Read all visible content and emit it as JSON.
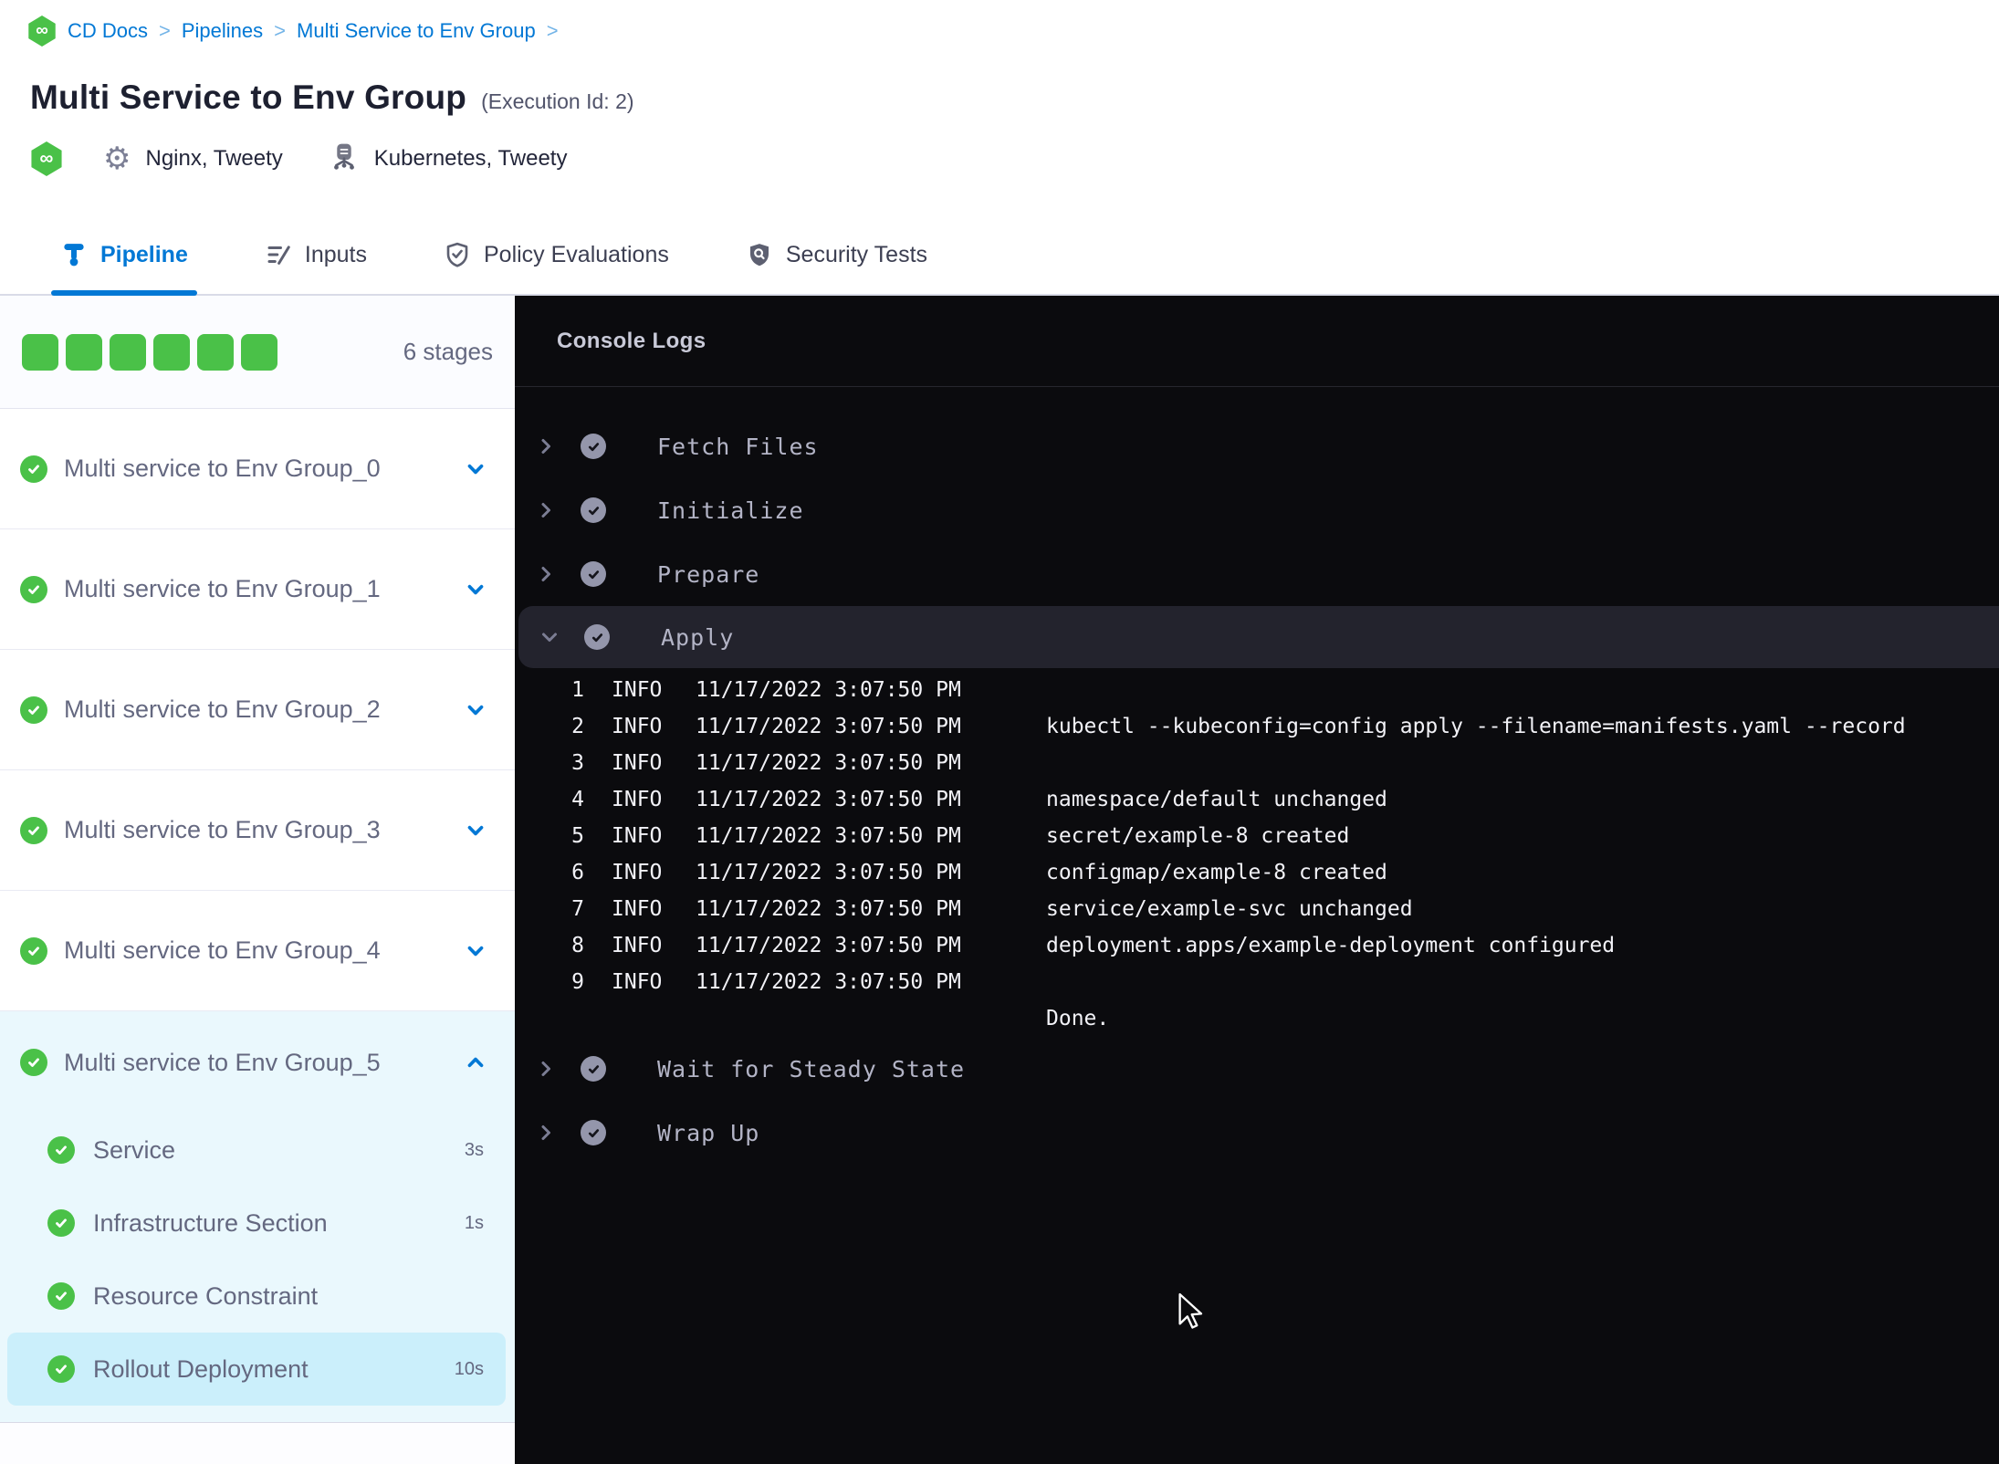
{
  "breadcrumb": {
    "separator": ">",
    "items": [
      "CD Docs",
      "Pipelines",
      "Multi Service to Env Group"
    ]
  },
  "header": {
    "title": "Multi Service to Env Group",
    "execution_id": "(Execution Id: 2)",
    "services_label": "Nginx, Tweety",
    "environments_label": "Kubernetes, Tweety"
  },
  "tabs": [
    {
      "label": "Pipeline",
      "icon": "pipeline-icon",
      "active": true
    },
    {
      "label": "Inputs",
      "icon": "inputs-icon",
      "active": false
    },
    {
      "label": "Policy Evaluations",
      "icon": "policy-evaluations-icon",
      "active": false
    },
    {
      "label": "Security Tests",
      "icon": "security-tests-icon",
      "active": false
    }
  ],
  "sidebar": {
    "stages_count_label": "6 stages",
    "status_squares": 6,
    "stages": [
      {
        "label": "Multi service to Env Group_0",
        "status": "success",
        "expanded": false
      },
      {
        "label": "Multi service to Env Group_1",
        "status": "success",
        "expanded": false
      },
      {
        "label": "Multi service to Env Group_2",
        "status": "success",
        "expanded": false
      },
      {
        "label": "Multi service to Env Group_3",
        "status": "success",
        "expanded": false
      },
      {
        "label": "Multi service to Env Group_4",
        "status": "success",
        "expanded": false
      },
      {
        "label": "Multi service to Env Group_5",
        "status": "success",
        "expanded": true,
        "steps": [
          {
            "label": "Service",
            "duration": "3s",
            "status": "success",
            "selected": false
          },
          {
            "label": "Infrastructure Section",
            "duration": "1s",
            "status": "success",
            "selected": false
          },
          {
            "label": "Resource Constraint",
            "duration": "",
            "status": "success",
            "selected": false
          },
          {
            "label": "Rollout Deployment",
            "duration": "10s",
            "status": "success",
            "selected": true
          }
        ]
      }
    ]
  },
  "console": {
    "title": "Console Logs",
    "steps": [
      {
        "label": "Fetch Files",
        "status": "success",
        "expanded": false
      },
      {
        "label": "Initialize",
        "status": "success",
        "expanded": false
      },
      {
        "label": "Prepare",
        "status": "success",
        "expanded": false
      },
      {
        "label": "Apply",
        "status": "success",
        "expanded": true,
        "logs": [
          {
            "num": "1",
            "level": "INFO",
            "time": "11/17/2022 3:07:50 PM",
            "message": ""
          },
          {
            "num": "2",
            "level": "INFO",
            "time": "11/17/2022 3:07:50 PM",
            "message": "kubectl --kubeconfig=config apply --filename=manifests.yaml --record"
          },
          {
            "num": "3",
            "level": "INFO",
            "time": "11/17/2022 3:07:50 PM",
            "message": ""
          },
          {
            "num": "4",
            "level": "INFO",
            "time": "11/17/2022 3:07:50 PM",
            "message": "namespace/default unchanged"
          },
          {
            "num": "5",
            "level": "INFO",
            "time": "11/17/2022 3:07:50 PM",
            "message": "secret/example-8 created"
          },
          {
            "num": "6",
            "level": "INFO",
            "time": "11/17/2022 3:07:50 PM",
            "message": "configmap/example-8 created"
          },
          {
            "num": "7",
            "level": "INFO",
            "time": "11/17/2022 3:07:50 PM",
            "message": "service/example-svc unchanged"
          },
          {
            "num": "8",
            "level": "INFO",
            "time": "11/17/2022 3:07:50 PM",
            "message": "deployment.apps/example-deployment configured"
          },
          {
            "num": "9",
            "level": "INFO",
            "time": "11/17/2022 3:07:50 PM",
            "message": ""
          },
          {
            "num": "",
            "level": "",
            "time": "",
            "message": "Done."
          }
        ]
      },
      {
        "label": "Wait for Steady State",
        "status": "success",
        "expanded": false
      },
      {
        "label": "Wrap Up",
        "status": "success",
        "expanded": false
      }
    ]
  },
  "colors": {
    "accent_blue": "#0278d5",
    "success_green": "#4ac148",
    "console_background": "#0b0b0e",
    "console_row_highlight": "#23232d",
    "selected_substep": "#cbeffb",
    "expanded_stage_background": "#eaf8fd"
  }
}
